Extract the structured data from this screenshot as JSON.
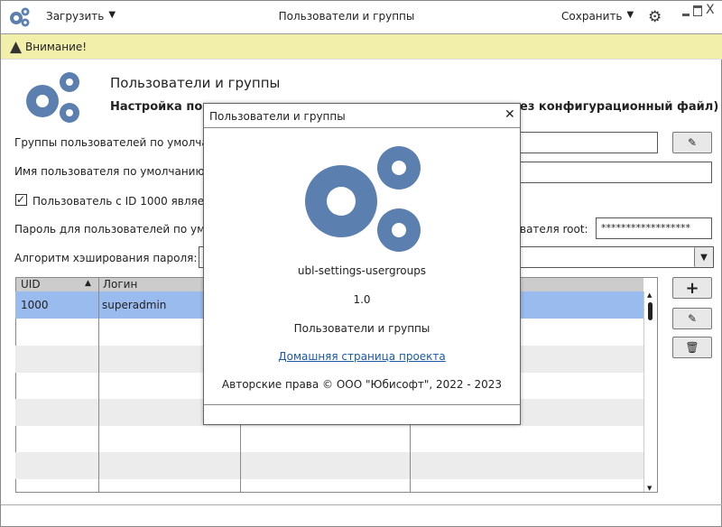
{
  "header": {
    "load_label": "Загрузить",
    "title": "Пользователи и группы",
    "save_label": "Сохранить"
  },
  "warning": {
    "text": "Внимание!"
  },
  "banner": {
    "title": "Пользователи и группы",
    "subtitle_left": "Настройка поль",
    "subtitle_right": "ез конфигурационный файл)"
  },
  "form": {
    "groups_label": "Группы пользователей по умолчани",
    "username_label": "Имя пользователя по умолчанию (ес",
    "uid1000_label": "Пользователь с ID 1000 являет",
    "uid1000_checked": true,
    "password_label": "Пароль для пользователей по умол",
    "root_label": "вателя root:",
    "root_password": "******************",
    "hash_label": "Алгоритм хэширования пароля:"
  },
  "table": {
    "columns": [
      "UID",
      "Логин",
      "",
      ""
    ],
    "rows": [
      {
        "uid": "1000",
        "login": "superadmin"
      }
    ]
  },
  "dialog": {
    "title": "Пользователи и группы",
    "app_name": "ubl-settings-usergroups",
    "version": "1.0",
    "description": "Пользователи и группы",
    "link": "Домашняя страница проекта",
    "copyright": "Авторские права © ООО \"Юбисофт\", 2022 - 2023"
  },
  "colors": {
    "accent": "#5b7fae",
    "warning_bg": "#f2efaa",
    "selected_row": "#99bbee"
  }
}
